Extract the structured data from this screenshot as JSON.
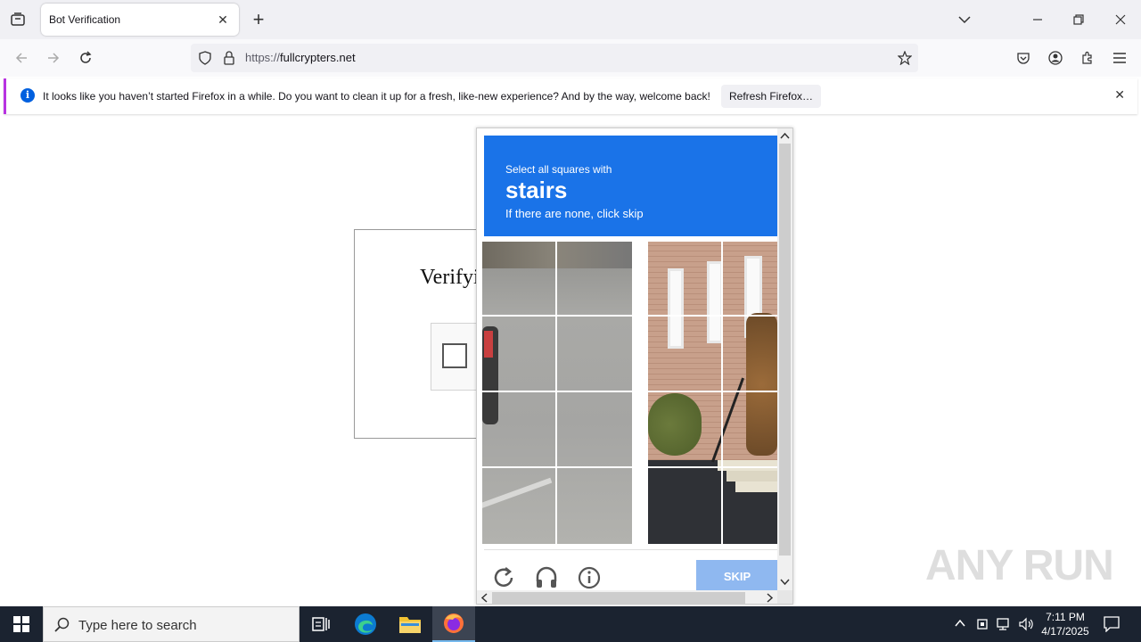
{
  "browser": {
    "tab_title": "Bot Verification",
    "url_prefix": "https://",
    "url_domain": "fullcrypters.net"
  },
  "notification": {
    "message": "It looks like you haven’t started Firefox in a while. Do you want to clean it up for a fresh, like-new experience? And by the way, welcome back!",
    "button_label": "Refresh Firefox…"
  },
  "page": {
    "heading": "Verifyi"
  },
  "captcha": {
    "instruction_line1": "Select all squares with",
    "target_object": "stairs",
    "instruction_line3": "If there are none, click skip",
    "skip_label": "SKIP"
  },
  "taskbar": {
    "search_placeholder": "Type here to search",
    "time": "7:11 PM",
    "date": "4/17/2025"
  },
  "watermark": "ANY RUN"
}
